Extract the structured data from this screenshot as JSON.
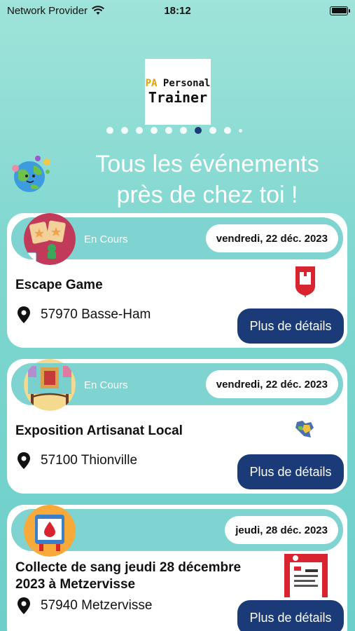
{
  "status_bar": {
    "carrier": "Network Provider",
    "time": "18:12"
  },
  "logo": {
    "line1_prefix": "PA",
    "line1_rest": "Personal",
    "line2": "Trainer"
  },
  "pager": {
    "count": 10,
    "active_index": 6
  },
  "headline": {
    "line1": "Tous les événements",
    "line2": "près de chez toi !"
  },
  "events": [
    {
      "status": "En Cours",
      "date": "vendredi, 22 déc. 2023",
      "title": "Escape Game",
      "location": "57970  Basse-Ham",
      "button": "Plus de détails"
    },
    {
      "status": "En Cours",
      "date": "vendredi, 22 déc. 2023",
      "title": "Exposition Artisanat Local",
      "location": "57100  Thionville",
      "button": "Plus de détails"
    },
    {
      "status": "",
      "date": "jeudi, 28 déc. 2023",
      "title_line1": "Collecte de sang  jeudi  28 décembre",
      "title_line2": "2023 à Metzervisse",
      "location": "57940  Metzervisse",
      "button": "Plus de détails"
    }
  ],
  "colors": {
    "accent": "#1a3a78",
    "band": "#7fd3d0"
  }
}
